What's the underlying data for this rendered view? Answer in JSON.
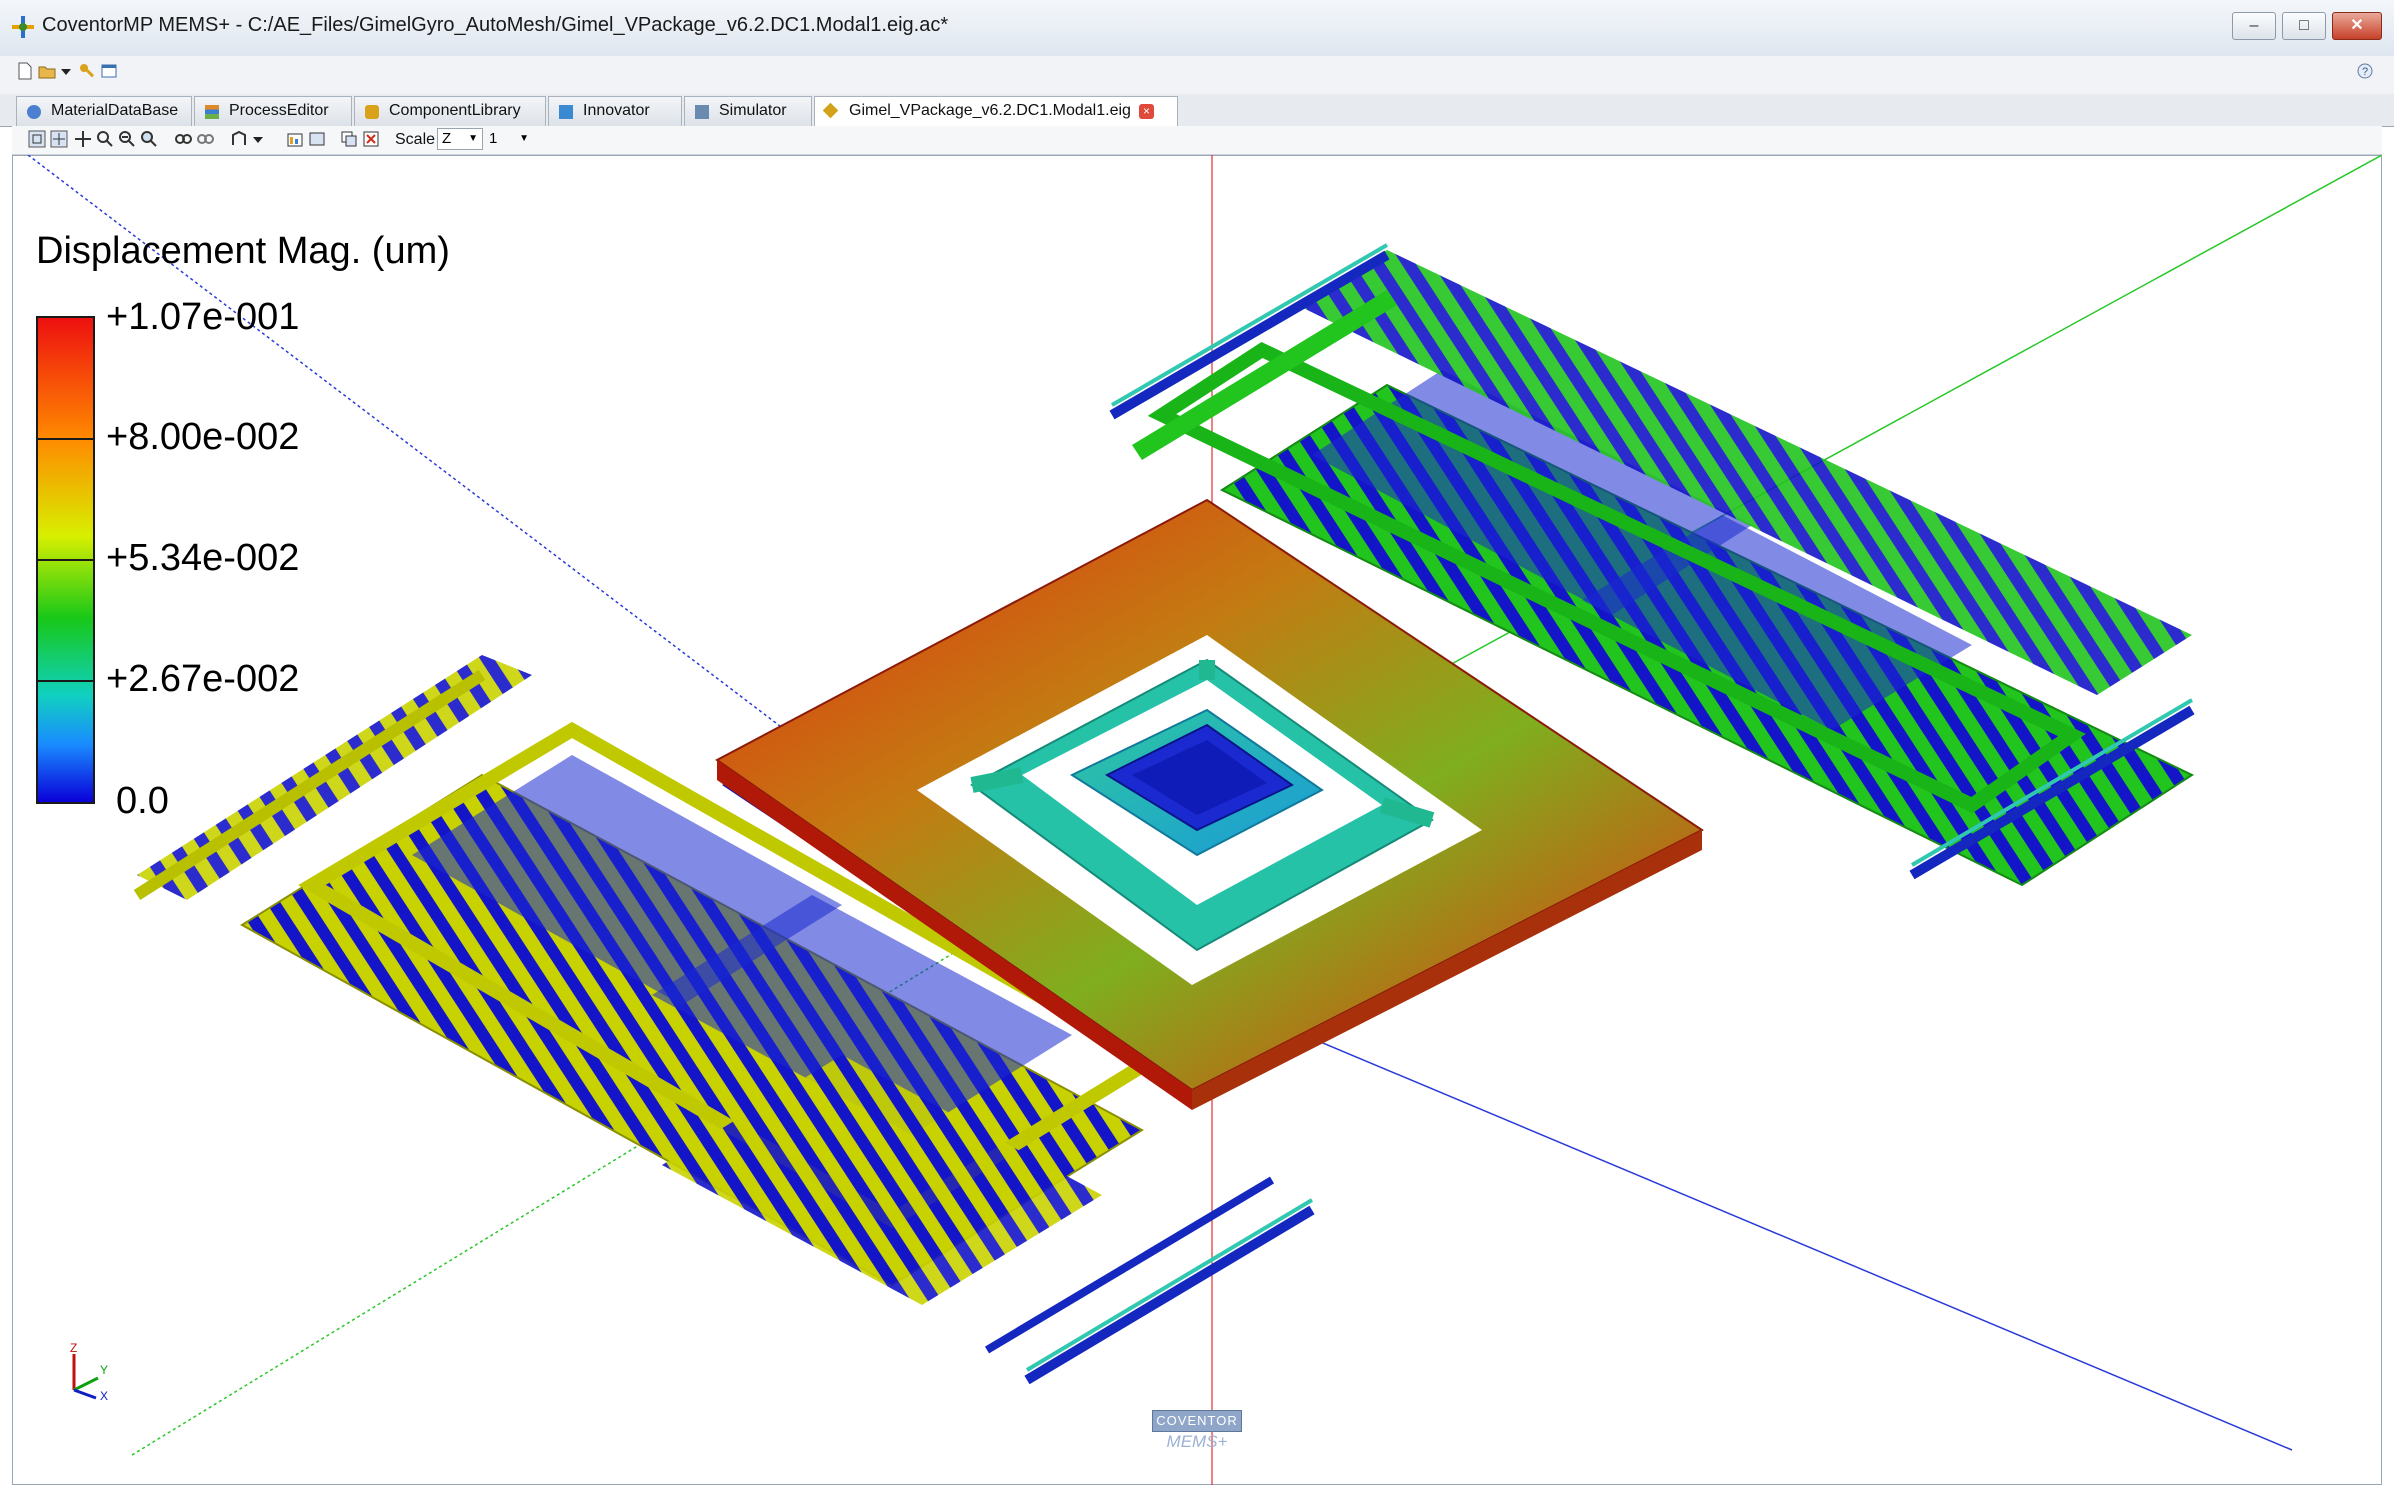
{
  "window": {
    "title": "CoventorMP MEMS+ - C:/AE_Files/GimelGyro_AutoMesh/Gimel_VPackage_v6.2.DC1.Modal1.eig.ac*",
    "minimize": "–",
    "maximize": "□",
    "close": "✕"
  },
  "tabs": [
    {
      "label": "MaterialDataBase",
      "icon": "material-icon"
    },
    {
      "label": "ProcessEditor",
      "icon": "process-icon"
    },
    {
      "label": "ComponentLibrary",
      "icon": "component-icon"
    },
    {
      "label": "Innovator",
      "icon": "innovator-icon"
    },
    {
      "label": "Simulator",
      "icon": "simulator-icon"
    },
    {
      "label": "Gimel_VPackage_v6.2.DC1.Modal1.eig",
      "icon": "result-icon",
      "active": true
    }
  ],
  "toolbar": {
    "scale_label": "Scale",
    "scale_axis": "Z",
    "scale_value": "1"
  },
  "legend": {
    "title": "Displacement Mag. (um)",
    "ticks": [
      "+1.07e-001",
      "+8.00e-002",
      "+5.34e-002",
      "+2.67e-002",
      "0.0"
    ]
  },
  "axis_triad": {
    "z": "Z",
    "y": "Y",
    "x": "X"
  },
  "branding": {
    "logo": "COVENTOR",
    "product": "MEMS+"
  },
  "colors": {
    "frame_hot": "#d61a0a",
    "frame_mid": "#78b020",
    "left_comb": "#c8d200",
    "right_comb": "#22c41e",
    "electrode": "#1414c8",
    "center_core": "#1a2ad0",
    "ring": "#2ec8c0"
  }
}
